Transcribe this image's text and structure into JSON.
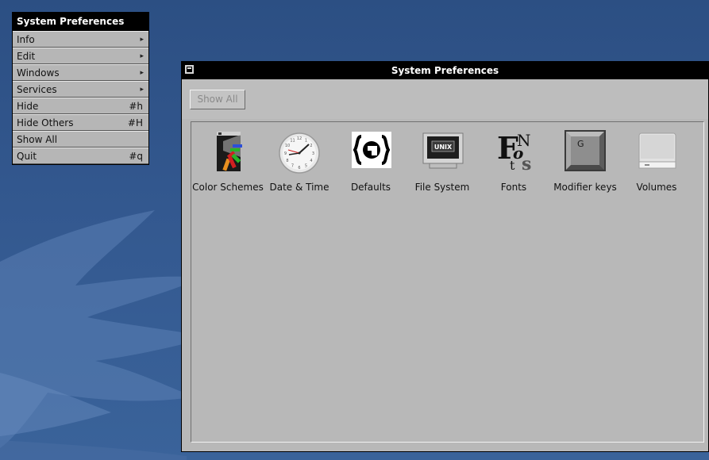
{
  "menu": {
    "title": "System Preferences",
    "items": [
      {
        "label": "Info",
        "key": "",
        "submenu": true
      },
      {
        "label": "Edit",
        "key": "",
        "submenu": true
      },
      {
        "label": "Windows",
        "key": "",
        "submenu": true
      },
      {
        "label": "Services",
        "key": "",
        "submenu": true
      },
      {
        "label": "Hide",
        "key": "#h",
        "submenu": false
      },
      {
        "label": "Hide Others",
        "key": "#H",
        "submenu": false
      },
      {
        "label": "Show All",
        "key": "",
        "submenu": false
      },
      {
        "label": "Quit",
        "key": "#q",
        "submenu": false
      }
    ],
    "submenu_glyph": "▸"
  },
  "window": {
    "title": "System Preferences",
    "show_all_label": "Show All",
    "show_all_enabled": false
  },
  "preferences": [
    {
      "label": "Color Schemes",
      "icon": "color-schemes-icon"
    },
    {
      "label": "Date & Time",
      "icon": "clock-icon"
    },
    {
      "label": "Defaults",
      "icon": "defaults-icon"
    },
    {
      "label": "File System",
      "icon": "unix-monitor-icon"
    },
    {
      "label": "Fonts",
      "icon": "fonts-icon"
    },
    {
      "label": "Modifier keys",
      "icon": "keyboard-key-icon"
    },
    {
      "label": "Volumes",
      "icon": "disk-drive-icon"
    }
  ],
  "clock_numbers": [
    "12",
    "1",
    "2",
    "3",
    "4",
    "5",
    "6",
    "7",
    "8",
    "9",
    "10",
    "11"
  ],
  "file_system_screen_text": "UNIX",
  "modifier_key_letter": "G",
  "fonts_glyphs": [
    "F",
    "N",
    "o",
    "t",
    "s"
  ],
  "colors": {
    "desktop": "#2c4f83",
    "window_bg": "#b8b8b8",
    "titlebar": "#000000",
    "menu_bg": "#b6b6b6"
  }
}
